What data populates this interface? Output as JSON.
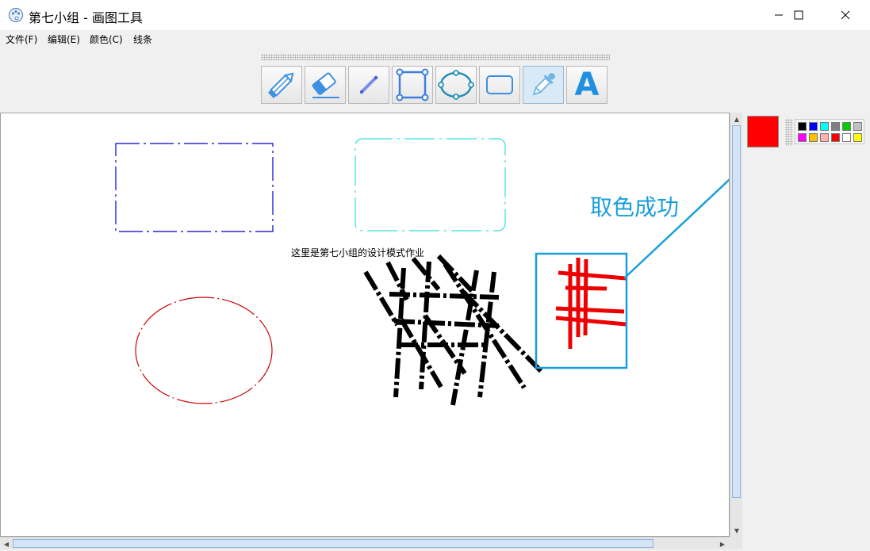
{
  "window": {
    "title": "第七小组 - 画图工具",
    "app_icon": "palette-icon",
    "controls": {
      "minimize": "minimize-icon",
      "maximize": "maximize-icon",
      "close": "close-icon"
    }
  },
  "menu": [
    {
      "label": "文件(F)"
    },
    {
      "label": "编辑(E)"
    },
    {
      "label": "颜色(C)"
    },
    {
      "label": "线条"
    }
  ],
  "toolbar": {
    "tools": [
      {
        "name": "pencil",
        "icon": "pencil-icon"
      },
      {
        "name": "eraser",
        "icon": "eraser-icon"
      },
      {
        "name": "line",
        "icon": "line-icon"
      },
      {
        "name": "rectangle",
        "icon": "rectangle-icon"
      },
      {
        "name": "oval",
        "icon": "oval-icon"
      },
      {
        "name": "rounded-rectangle",
        "icon": "rounded-rectangle-icon"
      },
      {
        "name": "color-picker",
        "icon": "eyedropper-icon",
        "selected": true
      },
      {
        "name": "text",
        "icon": "text-icon",
        "glyph": "A"
      }
    ]
  },
  "canvas": {
    "text": "这里是第七小组的设计模式作业",
    "annotation": "取色成功",
    "colors": {
      "rect_blue": "#0000cc",
      "rect_cyan": "#33dddd",
      "oval_red": "#cc0000",
      "scribble": "#000000",
      "fill_red": "#ee0000",
      "highlight": "#1a9edb"
    }
  },
  "colors": {
    "current": "#ff0000",
    "palette": [
      "#000000",
      "#0000ff",
      "#00ffff",
      "#808080",
      "#00cc00",
      "#c0c0c0",
      "#ff00ff",
      "#ffc000",
      "#ffb0b0",
      "#ff0000",
      "#ffffff",
      "#ffff00"
    ]
  }
}
